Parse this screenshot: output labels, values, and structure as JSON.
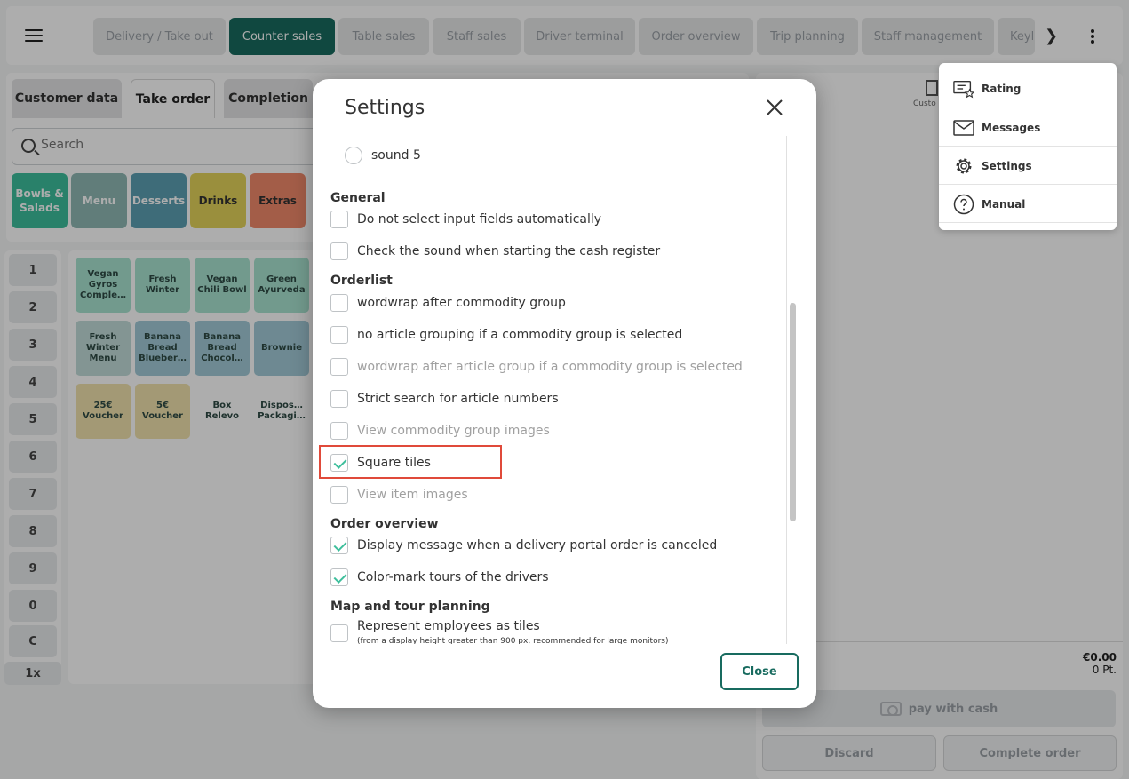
{
  "topbar": {
    "tabs": [
      {
        "label": "Delivery / Take out",
        "active": false
      },
      {
        "label": "Counter sales",
        "active": true
      },
      {
        "label": "Table sales",
        "active": false
      },
      {
        "label": "Staff sales",
        "active": false
      },
      {
        "label": "Driver terminal",
        "active": false
      },
      {
        "label": "Order overview",
        "active": false
      },
      {
        "label": "Trip planning",
        "active": false
      },
      {
        "label": "Staff management",
        "active": false
      },
      {
        "label": "Keyl",
        "active": false
      }
    ],
    "next_glyph": "❯"
  },
  "subtabs": [
    "Customer data",
    "Take order",
    "Completion"
  ],
  "search": {
    "placeholder": "Search"
  },
  "categories": [
    {
      "label": "Bowls & Salads",
      "color": "#3dbf9c"
    },
    {
      "label": "Menu",
      "color": "#8fb8b4"
    },
    {
      "label": "Desserts",
      "color": "#5c9fb3"
    },
    {
      "label": "Drinks",
      "color": "#e4d35a"
    },
    {
      "label": "Extras",
      "color": "#f08a6a"
    }
  ],
  "numpad": [
    "1",
    "2",
    "3",
    "4",
    "5",
    "6",
    "7",
    "8",
    "9",
    "0",
    "C",
    "1x"
  ],
  "items": [
    {
      "label": "Vegan Gyros Comple…",
      "color": "#a8e3d0"
    },
    {
      "label": "Fresh Winter",
      "color": "#a8e3d0"
    },
    {
      "label": "Vegan Chili Bowl",
      "color": "#a8e3d0"
    },
    {
      "label": "Green Ayurveda",
      "color": "#a8e3d0"
    },
    {
      "label": "Fresh Winter Menu",
      "color": "#c2dcd9"
    },
    {
      "label": "Banana Bread Blueber…",
      "color": "#a3cbd8"
    },
    {
      "label": "Banana Bread Chocol…",
      "color": "#a3cbd8"
    },
    {
      "label": "Brownie",
      "color": "#a3cbd8"
    },
    {
      "label": "25€ Voucher",
      "color": "#f1e2ad"
    },
    {
      "label": "5€ Voucher",
      "color": "#f1e2ad"
    },
    {
      "label": "Box Relevo",
      "color": "#ffffff"
    },
    {
      "label": "Dispos… Packagi…",
      "color": "#ffffff"
    }
  ],
  "right_panel": {
    "customer_label": "Custo",
    "total": "€0.00",
    "points": "0 Pt.",
    "pay_label": "pay with cash",
    "discard_label": "Discard",
    "complete_label": "Complete order"
  },
  "menu": {
    "items": [
      {
        "label": "Rating",
        "icon": "rating-icon"
      },
      {
        "label": "Messages",
        "icon": "envelope-icon"
      },
      {
        "label": "Settings",
        "icon": "gear-icon"
      },
      {
        "label": "Manual",
        "icon": "question-icon"
      }
    ]
  },
  "dialog": {
    "title": "Settings",
    "close_label": "Close",
    "radio_sound5": "sound 5",
    "sections": {
      "general": "General",
      "orderlist": "Orderlist",
      "order_overview": "Order overview",
      "map": "Map and tour planning"
    },
    "options": {
      "no_auto_select": {
        "label": "Do not select input fields automatically",
        "checked": false,
        "disabled": false
      },
      "check_sound": {
        "label": "Check the sound when starting the cash register",
        "checked": false,
        "disabled": false
      },
      "wordwrap_commodity": {
        "label": "wordwrap after commodity group",
        "checked": false,
        "disabled": false
      },
      "no_article_grouping": {
        "label": "no article grouping if a commodity group is selected",
        "checked": false,
        "disabled": false
      },
      "wordwrap_article": {
        "label": "wordwrap after article group if a commodity group is selected",
        "checked": false,
        "disabled": true
      },
      "strict_search": {
        "label": "Strict search for article numbers",
        "checked": false,
        "disabled": false
      },
      "view_commodity_images": {
        "label": "View commodity group images",
        "checked": false,
        "disabled": true
      },
      "square_tiles": {
        "label": "Square tiles",
        "checked": true,
        "disabled": false
      },
      "view_item_images": {
        "label": "View item images",
        "checked": false,
        "disabled": true
      },
      "display_canceled": {
        "label": "Display message when a delivery portal order is canceled",
        "checked": true,
        "disabled": false
      },
      "color_mark_tours": {
        "label": "Color-mark tours of the drivers",
        "checked": true,
        "disabled": false
      },
      "employees_tiles": {
        "label": "Represent employees as tiles",
        "checked": false,
        "disabled": false
      }
    },
    "employees_note": "(from a display height greater than 900 px, recommended for large monitors)"
  },
  "colors": {
    "brand": "#186b5f",
    "check": "#3dbf9c",
    "highlight": "#e04a3a"
  }
}
